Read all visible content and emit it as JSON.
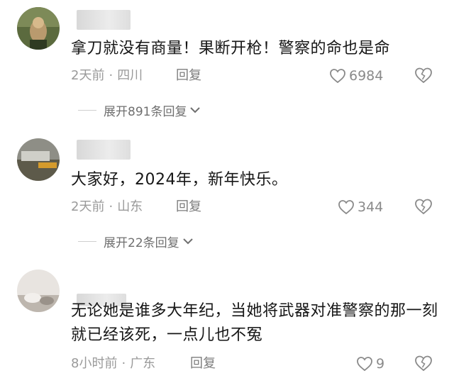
{
  "comments": [
    {
      "text": "拿刀就没有商量！果断开枪！警察的命也是命",
      "time": "2天前",
      "location": "四川",
      "reply_label": "回复",
      "likes": "6984",
      "expand": "展开891条回复"
    },
    {
      "text": "大家好，2024年，新年快乐。",
      "time": "2天前",
      "location": "山东",
      "reply_label": "回复",
      "likes": "344",
      "expand": "展开22条回复"
    },
    {
      "text": "无论她是谁多大年纪，当她将武器对准警察的那一刻就已经该死，一点儿也不冤",
      "time": "8小时前",
      "location": "广东",
      "reply_label": "回复",
      "likes": "9"
    }
  ],
  "separator": "·",
  "icons": {
    "like": "heart-outline-icon",
    "dislike": "broken-heart-icon",
    "expand": "chevron-down-icon"
  },
  "colors": {
    "text": "#161616",
    "meta": "#9a9a9a",
    "icon": "#8a8a8a"
  }
}
